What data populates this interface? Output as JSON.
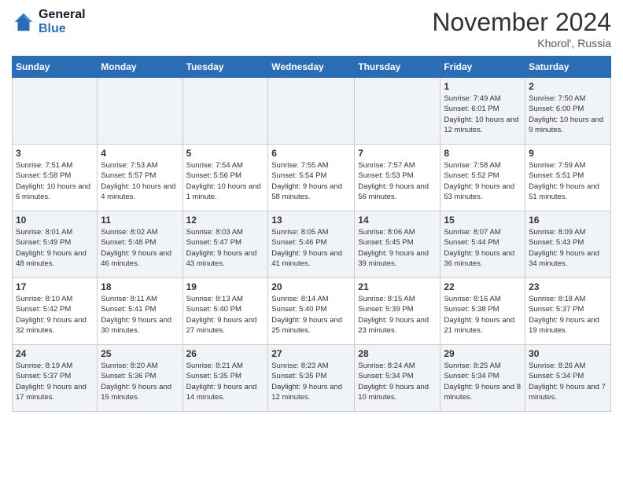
{
  "header": {
    "logo_line1": "General",
    "logo_line2": "Blue",
    "month": "November 2024",
    "location": "Khorol', Russia"
  },
  "weekdays": [
    "Sunday",
    "Monday",
    "Tuesday",
    "Wednesday",
    "Thursday",
    "Friday",
    "Saturday"
  ],
  "weeks": [
    [
      {
        "day": "",
        "info": ""
      },
      {
        "day": "",
        "info": ""
      },
      {
        "day": "",
        "info": ""
      },
      {
        "day": "",
        "info": ""
      },
      {
        "day": "",
        "info": ""
      },
      {
        "day": "1",
        "info": "Sunrise: 7:49 AM\nSunset: 6:01 PM\nDaylight: 10 hours and 12 minutes."
      },
      {
        "day": "2",
        "info": "Sunrise: 7:50 AM\nSunset: 6:00 PM\nDaylight: 10 hours and 9 minutes."
      }
    ],
    [
      {
        "day": "3",
        "info": "Sunrise: 7:51 AM\nSunset: 5:58 PM\nDaylight: 10 hours and 6 minutes."
      },
      {
        "day": "4",
        "info": "Sunrise: 7:53 AM\nSunset: 5:57 PM\nDaylight: 10 hours and 4 minutes."
      },
      {
        "day": "5",
        "info": "Sunrise: 7:54 AM\nSunset: 5:56 PM\nDaylight: 10 hours and 1 minute."
      },
      {
        "day": "6",
        "info": "Sunrise: 7:55 AM\nSunset: 5:54 PM\nDaylight: 9 hours and 58 minutes."
      },
      {
        "day": "7",
        "info": "Sunrise: 7:57 AM\nSunset: 5:53 PM\nDaylight: 9 hours and 56 minutes."
      },
      {
        "day": "8",
        "info": "Sunrise: 7:58 AM\nSunset: 5:52 PM\nDaylight: 9 hours and 53 minutes."
      },
      {
        "day": "9",
        "info": "Sunrise: 7:59 AM\nSunset: 5:51 PM\nDaylight: 9 hours and 51 minutes."
      }
    ],
    [
      {
        "day": "10",
        "info": "Sunrise: 8:01 AM\nSunset: 5:49 PM\nDaylight: 9 hours and 48 minutes."
      },
      {
        "day": "11",
        "info": "Sunrise: 8:02 AM\nSunset: 5:48 PM\nDaylight: 9 hours and 46 minutes."
      },
      {
        "day": "12",
        "info": "Sunrise: 8:03 AM\nSunset: 5:47 PM\nDaylight: 9 hours and 43 minutes."
      },
      {
        "day": "13",
        "info": "Sunrise: 8:05 AM\nSunset: 5:46 PM\nDaylight: 9 hours and 41 minutes."
      },
      {
        "day": "14",
        "info": "Sunrise: 8:06 AM\nSunset: 5:45 PM\nDaylight: 9 hours and 39 minutes."
      },
      {
        "day": "15",
        "info": "Sunrise: 8:07 AM\nSunset: 5:44 PM\nDaylight: 9 hours and 36 minutes."
      },
      {
        "day": "16",
        "info": "Sunrise: 8:09 AM\nSunset: 5:43 PM\nDaylight: 9 hours and 34 minutes."
      }
    ],
    [
      {
        "day": "17",
        "info": "Sunrise: 8:10 AM\nSunset: 5:42 PM\nDaylight: 9 hours and 32 minutes."
      },
      {
        "day": "18",
        "info": "Sunrise: 8:11 AM\nSunset: 5:41 PM\nDaylight: 9 hours and 30 minutes."
      },
      {
        "day": "19",
        "info": "Sunrise: 8:13 AM\nSunset: 5:40 PM\nDaylight: 9 hours and 27 minutes."
      },
      {
        "day": "20",
        "info": "Sunrise: 8:14 AM\nSunset: 5:40 PM\nDaylight: 9 hours and 25 minutes."
      },
      {
        "day": "21",
        "info": "Sunrise: 8:15 AM\nSunset: 5:39 PM\nDaylight: 9 hours and 23 minutes."
      },
      {
        "day": "22",
        "info": "Sunrise: 8:16 AM\nSunset: 5:38 PM\nDaylight: 9 hours and 21 minutes."
      },
      {
        "day": "23",
        "info": "Sunrise: 8:18 AM\nSunset: 5:37 PM\nDaylight: 9 hours and 19 minutes."
      }
    ],
    [
      {
        "day": "24",
        "info": "Sunrise: 8:19 AM\nSunset: 5:37 PM\nDaylight: 9 hours and 17 minutes."
      },
      {
        "day": "25",
        "info": "Sunrise: 8:20 AM\nSunset: 5:36 PM\nDaylight: 9 hours and 15 minutes."
      },
      {
        "day": "26",
        "info": "Sunrise: 8:21 AM\nSunset: 5:35 PM\nDaylight: 9 hours and 14 minutes."
      },
      {
        "day": "27",
        "info": "Sunrise: 8:23 AM\nSunset: 5:35 PM\nDaylight: 9 hours and 12 minutes."
      },
      {
        "day": "28",
        "info": "Sunrise: 8:24 AM\nSunset: 5:34 PM\nDaylight: 9 hours and 10 minutes."
      },
      {
        "day": "29",
        "info": "Sunrise: 8:25 AM\nSunset: 5:34 PM\nDaylight: 9 hours and 8 minutes."
      },
      {
        "day": "30",
        "info": "Sunrise: 8:26 AM\nSunset: 5:34 PM\nDaylight: 9 hours and 7 minutes."
      }
    ]
  ]
}
